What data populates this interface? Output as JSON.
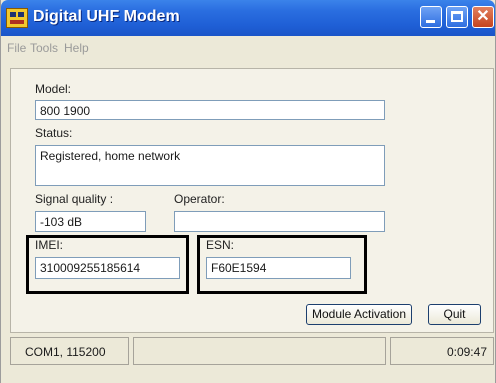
{
  "window": {
    "title": "Digital UHF Modem"
  },
  "menu": {
    "file": "File",
    "tools": "Tools",
    "help": "Help"
  },
  "form": {
    "model_label": "Model:",
    "model_value": "800 1900",
    "status_label": "Status:",
    "status_value": "Registered, home network",
    "signal_label": "Signal quality :",
    "signal_value": "-103 dB",
    "operator_label": "Operator:",
    "operator_value": "",
    "imei_label": "IMEI:",
    "imei_value": "310009255185614",
    "esn_label": "ESN:",
    "esn_value": "F60E1594"
  },
  "buttons": {
    "activation": "Module Activation",
    "quit": "Quit"
  },
  "statusbar": {
    "port": "COM1, 115200",
    "middle": "",
    "time": "0:09:47"
  },
  "colors": {
    "titlebar": "#2a6ee0",
    "close_button": "#c5441f",
    "highlight_border": "#000000"
  }
}
